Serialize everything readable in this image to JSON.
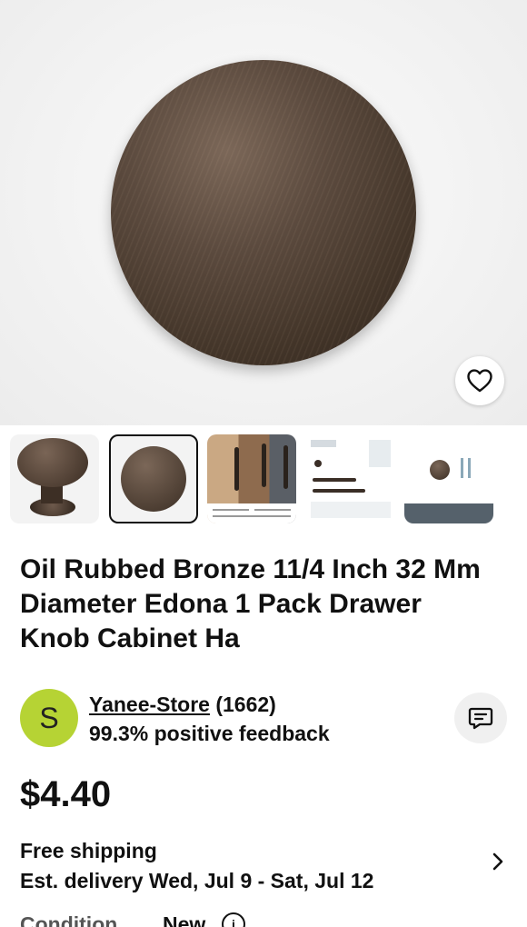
{
  "product": {
    "title": "Oil Rubbed Bronze 11/4 Inch 32 Mm Diameter Edona 1 Pack Drawer Knob Cabinet Ha",
    "price": "$4.40",
    "selected_thumbnail_index": 1,
    "thumbnail_count": 6
  },
  "seller": {
    "initial": "S",
    "name": "Yanee-Store",
    "rating_count": "(1662)",
    "feedback": "99.3% positive feedback",
    "avatar_color": "#b6d334"
  },
  "shipping": {
    "title": "Free shipping",
    "estimate": "Est. delivery Wed, Jul 9 - Sat, Jul 12"
  },
  "condition": {
    "label": "Condition",
    "value": "New"
  },
  "icons": {
    "favorite": "heart-outline-icon",
    "message": "chat-bubble-icon",
    "chevron": "chevron-right-icon",
    "info": "info-icon"
  }
}
